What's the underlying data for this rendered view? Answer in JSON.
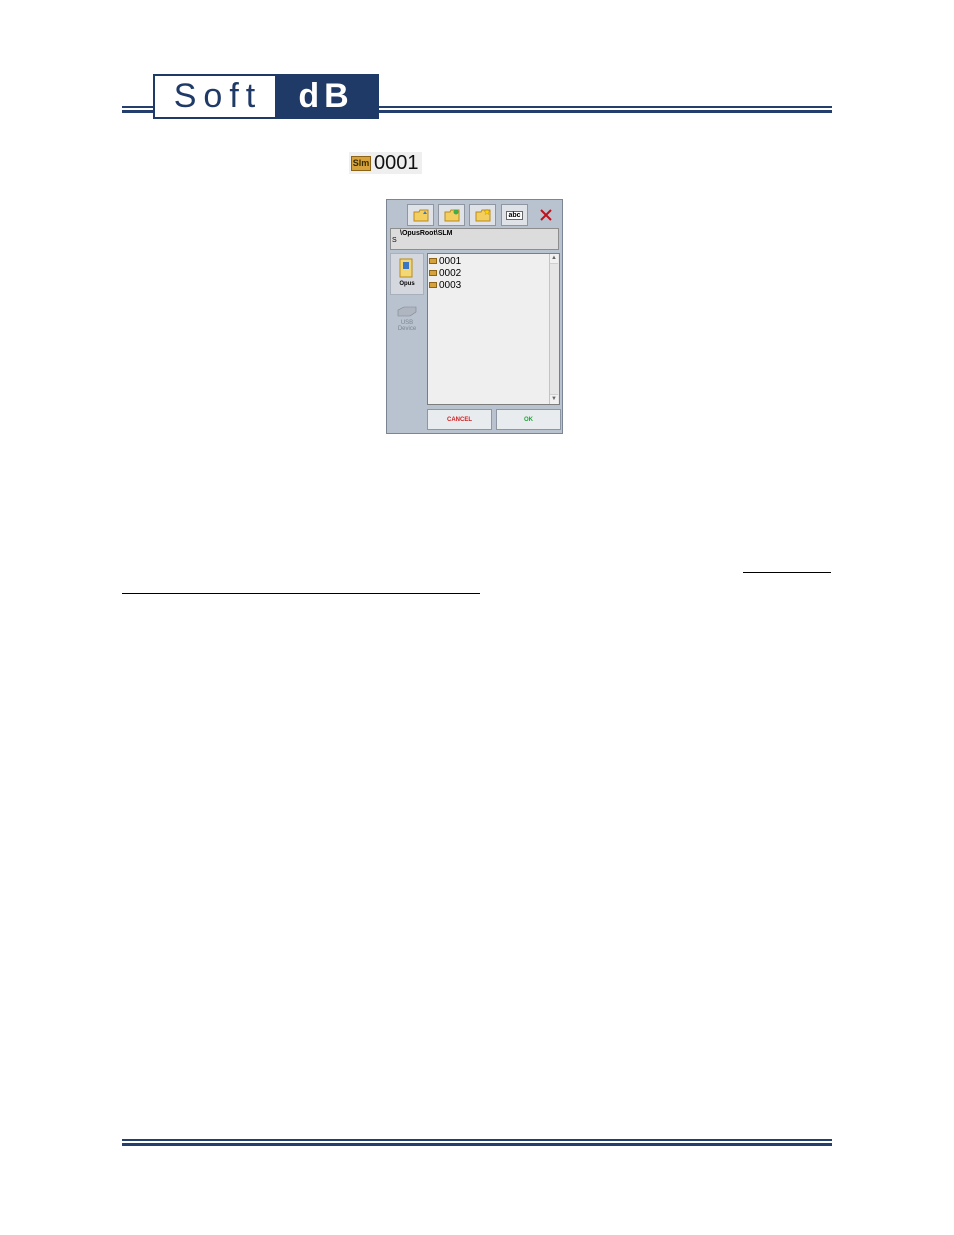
{
  "header": {
    "logo_left": "Soft",
    "logo_right": "dB"
  },
  "sample_icon": {
    "badge": "Slm",
    "label": "0001"
  },
  "dialog": {
    "toolbar_icons": [
      "folder-up-icon",
      "folder-refresh-icon",
      "new-folder-icon",
      "rename-icon",
      "close-icon"
    ],
    "rename_label": "abc",
    "path_marker": "S",
    "path": "\\OpusRoot\\SLM",
    "sidebar": {
      "opus_label": "Opus",
      "usb_label_1": "USB",
      "usb_label_2": "Device"
    },
    "files": [
      "0001",
      "0002",
      "0003"
    ],
    "cancel_label": "CANCEL",
    "ok_label": "OK",
    "colors": {
      "cancel": "#d21e1e",
      "ok": "#1fa53a",
      "close": "#c0121c",
      "folder": "#d6a23c"
    }
  }
}
